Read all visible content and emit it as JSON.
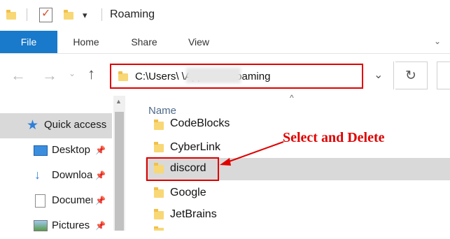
{
  "window": {
    "title": "Roaming"
  },
  "ribbon": {
    "tabs": [
      "File",
      "Home",
      "Share",
      "View"
    ]
  },
  "navigation": {
    "address_path": "C:\\Users\\          \\AppData\\Roaming"
  },
  "sidebar": {
    "items": [
      {
        "label": "Quick access",
        "icon": "star-icon"
      },
      {
        "label": "Desktop",
        "icon": "desktop-icon",
        "pinned": true
      },
      {
        "label": "Downloads",
        "icon": "download-arrow-icon",
        "pinned": true
      },
      {
        "label": "Documents",
        "icon": "document-icon",
        "pinned": true
      },
      {
        "label": "Pictures",
        "icon": "pictures-icon",
        "pinned": true
      }
    ]
  },
  "file_list": {
    "column_header": "Name",
    "rows": [
      {
        "name": "CodeBlocks"
      },
      {
        "name": "CyberLink"
      },
      {
        "name": "discord",
        "selected": true
      },
      {
        "name": "Google"
      },
      {
        "name": "JetBrains"
      }
    ]
  },
  "annotation": {
    "text": "Select and Delete",
    "color": "#e00000"
  },
  "colors": {
    "file_tab": "#1979ca",
    "highlight": "#e00000",
    "selection": "#d9d9d9"
  }
}
